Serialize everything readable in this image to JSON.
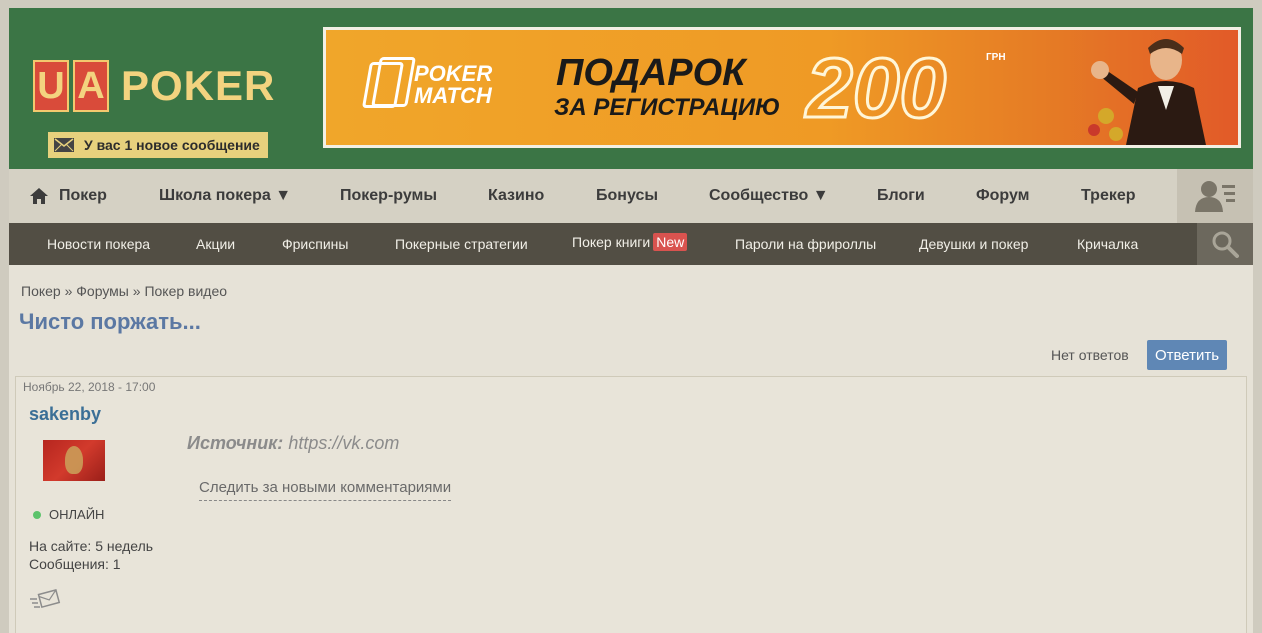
{
  "header": {
    "logo_letters": [
      "U",
      "A"
    ],
    "logo_word": "POKER",
    "message_notice": "У вас 1 новое сообщение",
    "banner": {
      "brand": "POKER MATCH",
      "headline": "ПОДАРОК",
      "subline": "ЗА РЕГИСТРАЦИЮ",
      "amount": "200",
      "currency": "ГРН"
    }
  },
  "main_nav": {
    "items": [
      "Покер",
      "Школа покера ▼",
      "Покер-румы",
      "Казино",
      "Бонусы",
      "Сообщество ▼",
      "Блоги",
      "Форум",
      "Трекер"
    ]
  },
  "sub_nav": {
    "items": [
      "Новости покера",
      "Акции",
      "Фриспины",
      "Покерные стратегии",
      "Покер книги",
      "Пароли на фрироллы",
      "Девушки и покер",
      "Кричалка"
    ],
    "new_badge": "New"
  },
  "breadcrumb": {
    "items": [
      "Покер",
      "Форумы",
      "Покер видео"
    ],
    "separator": "»"
  },
  "topic": {
    "title": "Чисто поржать...",
    "no_replies": "Нет ответов",
    "reply_button": "Ответить"
  },
  "post": {
    "date": "Ноябрь 22, 2018 - 17:00",
    "author": "sakenby",
    "status": "ОНЛАЙН",
    "on_site": "На сайте: 5 недель",
    "messages": "Сообщения: 1",
    "source_label": "Источник:",
    "source_value": "https://vk.com",
    "follow_link": "Следить за новыми комментариями"
  },
  "colors": {
    "header_green": "#3b7545",
    "logo_red": "#d94b3a",
    "logo_yellow": "#f3d37f",
    "banner_orange": "#f0a62a",
    "subnav_dark": "#524e44",
    "title_blue": "#5b78a3",
    "reply_blue": "#5f87b5",
    "online_green": "#5cc36b"
  },
  "icons": [
    "envelope-icon",
    "home-icon",
    "user-menu-icon",
    "search-icon",
    "online-dot-icon",
    "send-message-icon"
  ]
}
